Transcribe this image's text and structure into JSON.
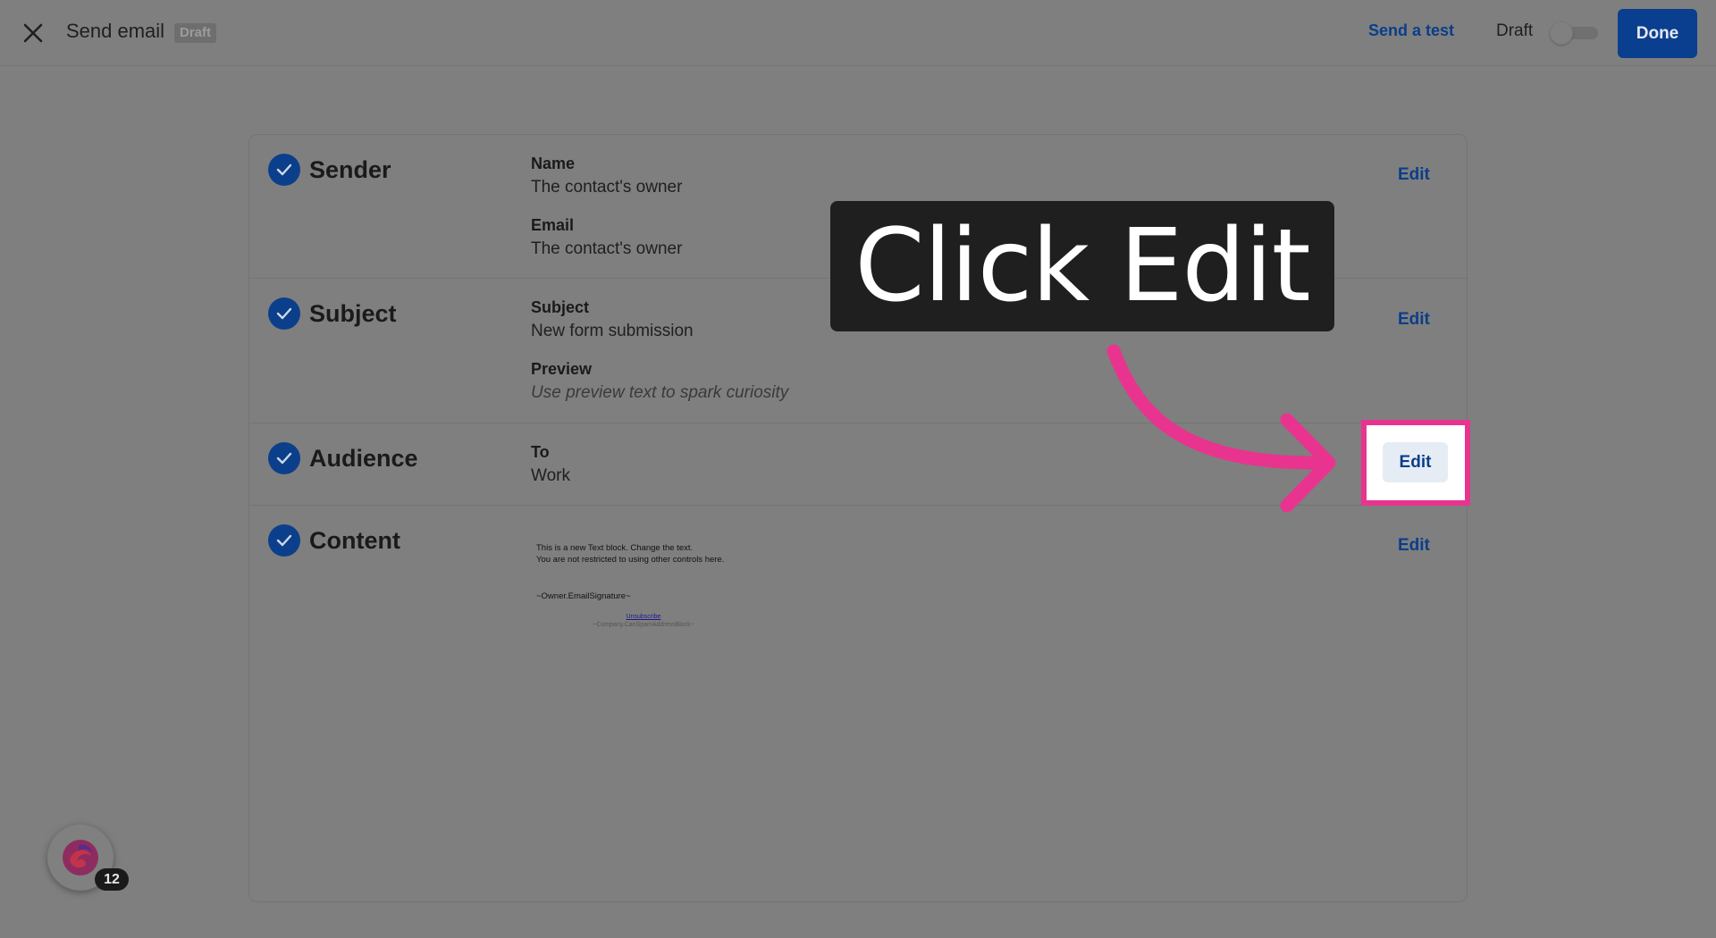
{
  "header": {
    "title": "Send email",
    "status_badge": "Draft",
    "send_test_label": "Send a test",
    "draft_toggle_label": "Draft",
    "draft_toggle_on": false,
    "done_label": "Done"
  },
  "sections": [
    {
      "title": "Sender",
      "edit_label": "Edit",
      "fields": [
        {
          "label": "Name",
          "value": "The contact's owner"
        },
        {
          "label": "Email",
          "value": "The contact's owner"
        }
      ]
    },
    {
      "title": "Subject",
      "edit_label": "Edit",
      "fields": [
        {
          "label": "Subject",
          "value": "New form submission"
        },
        {
          "label": "Preview",
          "value": "Use preview text to spark curiosity"
        }
      ]
    },
    {
      "title": "Audience",
      "edit_label": "Edit",
      "fields": [
        {
          "label": "To",
          "value": "Work"
        }
      ]
    },
    {
      "title": "Content",
      "edit_label": "Edit",
      "preview": {
        "line1": "This is a new Text block. Change the text.",
        "line2": "You are not restricted to using other controls here.",
        "signature": "~Owner.EmailSignature~",
        "unsubscribe": "Unsubscribe",
        "address": "~Company.CanSpamAddressBlock~"
      }
    }
  ],
  "callout": {
    "text": "Click Edit",
    "arrow_color": "#e8348f"
  },
  "widget": {
    "badge_count": "12"
  },
  "colors": {
    "accent": "#0a3e8a",
    "highlight": "#e8348f",
    "overlay": "#7f7f7f"
  }
}
